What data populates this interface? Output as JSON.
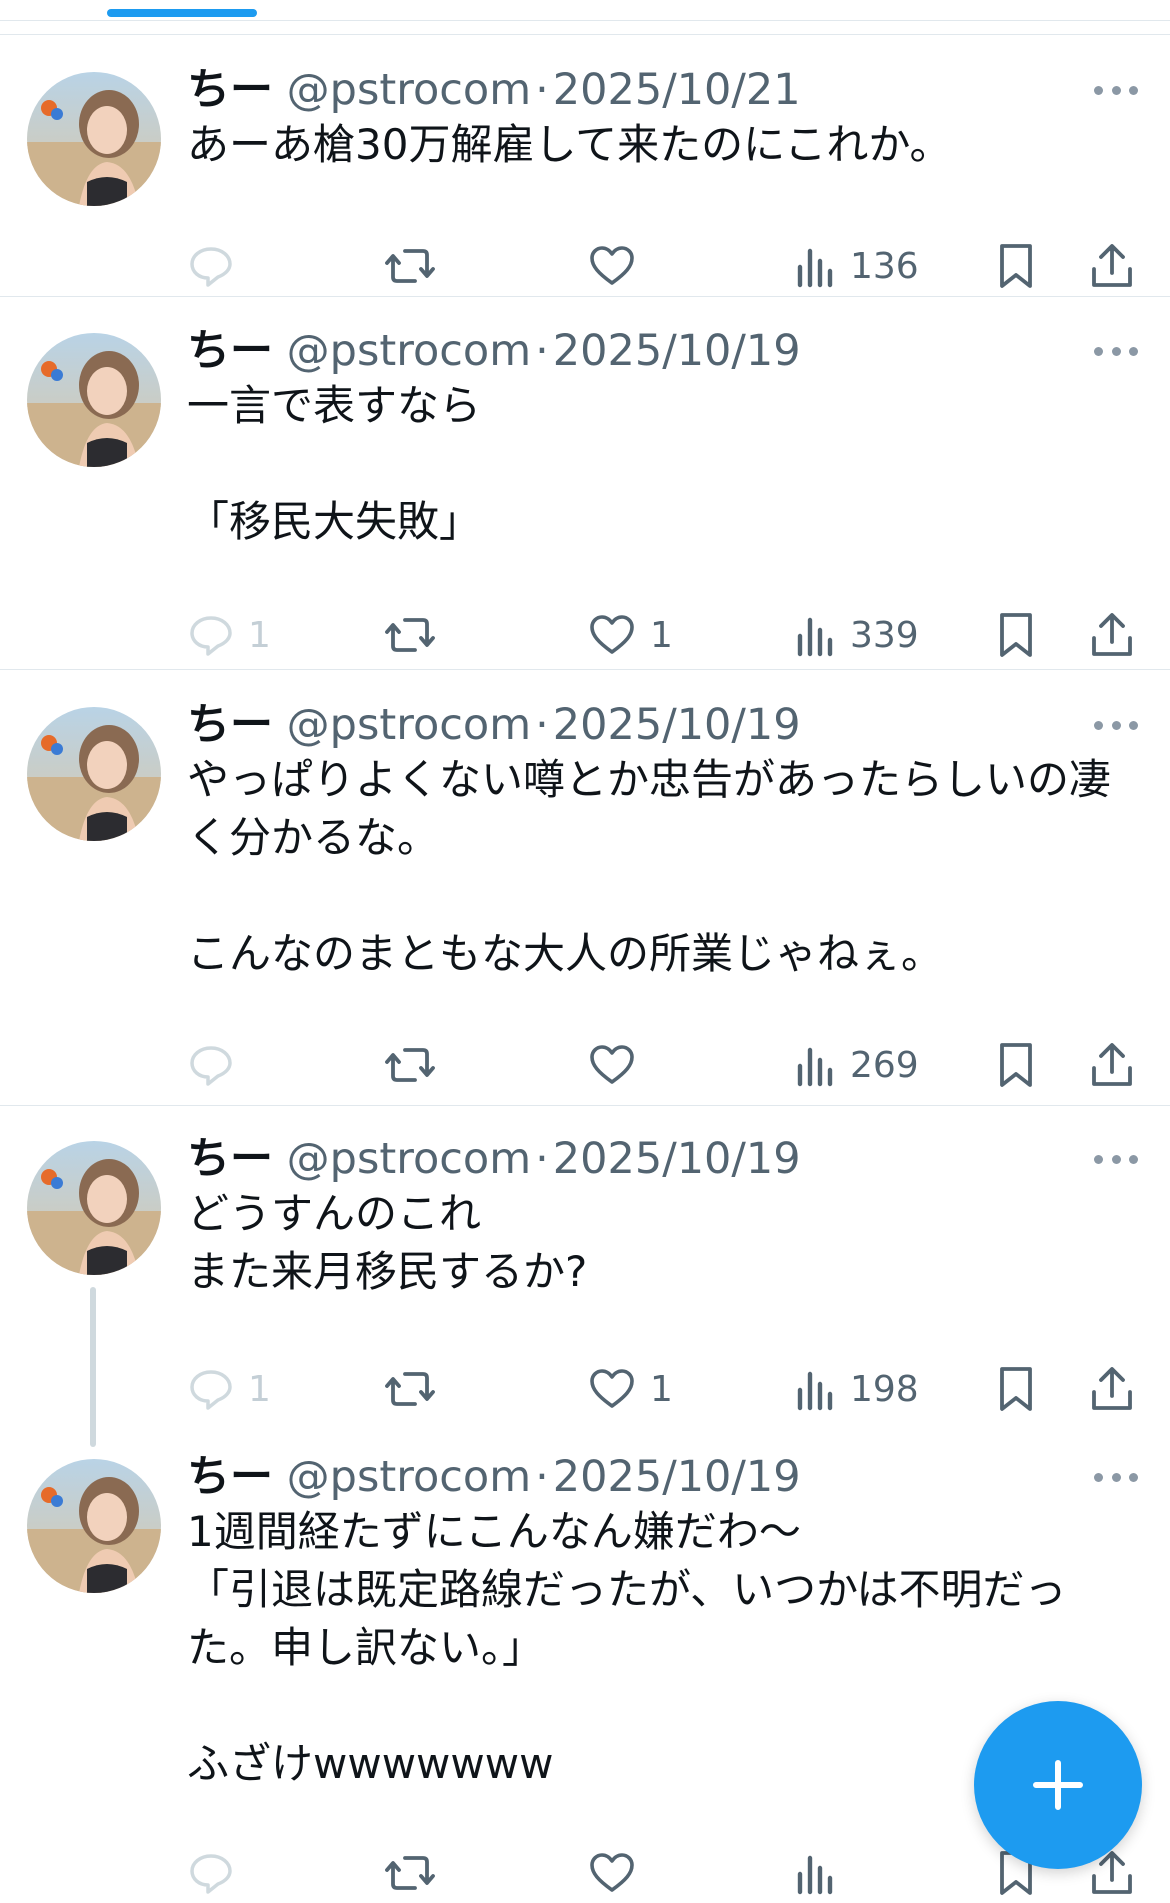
{
  "colors": {
    "accent": "#1d9bf0",
    "text": "#0f1419",
    "secondary": "#536471",
    "divider": "#e1e8ed"
  },
  "icons": {
    "reply": "reply-bubble-icon",
    "retweet": "retweet-icon",
    "like": "heart-icon",
    "views": "bar-chart-icon",
    "bookmark": "bookmark-icon",
    "share": "share-upload-icon",
    "more": "more-dots-icon",
    "compose": "plus-icon"
  },
  "tweets": [
    {
      "name": "ちー",
      "handle": "@pstrocom",
      "sep": "·",
      "date": "2025/10/21",
      "lines": [
        "あーあ槍30万解雇して来たのにこれか。"
      ],
      "replies": "",
      "retweets": "",
      "likes": "",
      "views": "136"
    },
    {
      "name": "ちー",
      "handle": "@pstrocom",
      "sep": "·",
      "date": "2025/10/19",
      "lines": [
        "一言で表すなら",
        "",
        "「移民大失敗」"
      ],
      "replies": "1",
      "retweets": "",
      "likes": "1",
      "views": "339"
    },
    {
      "name": "ちー",
      "handle": "@pstrocom",
      "sep": "·",
      "date": "2025/10/19",
      "lines": [
        "やっぱりよくない噂とか忠告があったらしいの凄",
        "く分かるな。",
        "",
        "こんなのまともな大人の所業じゃねぇ。"
      ],
      "replies": "",
      "retweets": "",
      "likes": "",
      "views": "269"
    },
    {
      "name": "ちー",
      "handle": "@pstrocom",
      "sep": "·",
      "date": "2025/10/19",
      "lines": [
        "どうすんのこれ",
        "また来月移民するか?"
      ],
      "replies": "1",
      "retweets": "",
      "likes": "1",
      "views": "198"
    },
    {
      "name": "ちー",
      "handle": "@pstrocom",
      "sep": "·",
      "date": "2025/10/19",
      "lines": [
        "1週間経たずにこんなん嫌だわ〜",
        "「引退は既定路線だったが、いつかは不明だっ",
        "た。申し訳ない。」",
        "",
        "ふざけwwwwwww"
      ],
      "replies": "",
      "retweets": "",
      "likes": "",
      "views": ""
    }
  ]
}
